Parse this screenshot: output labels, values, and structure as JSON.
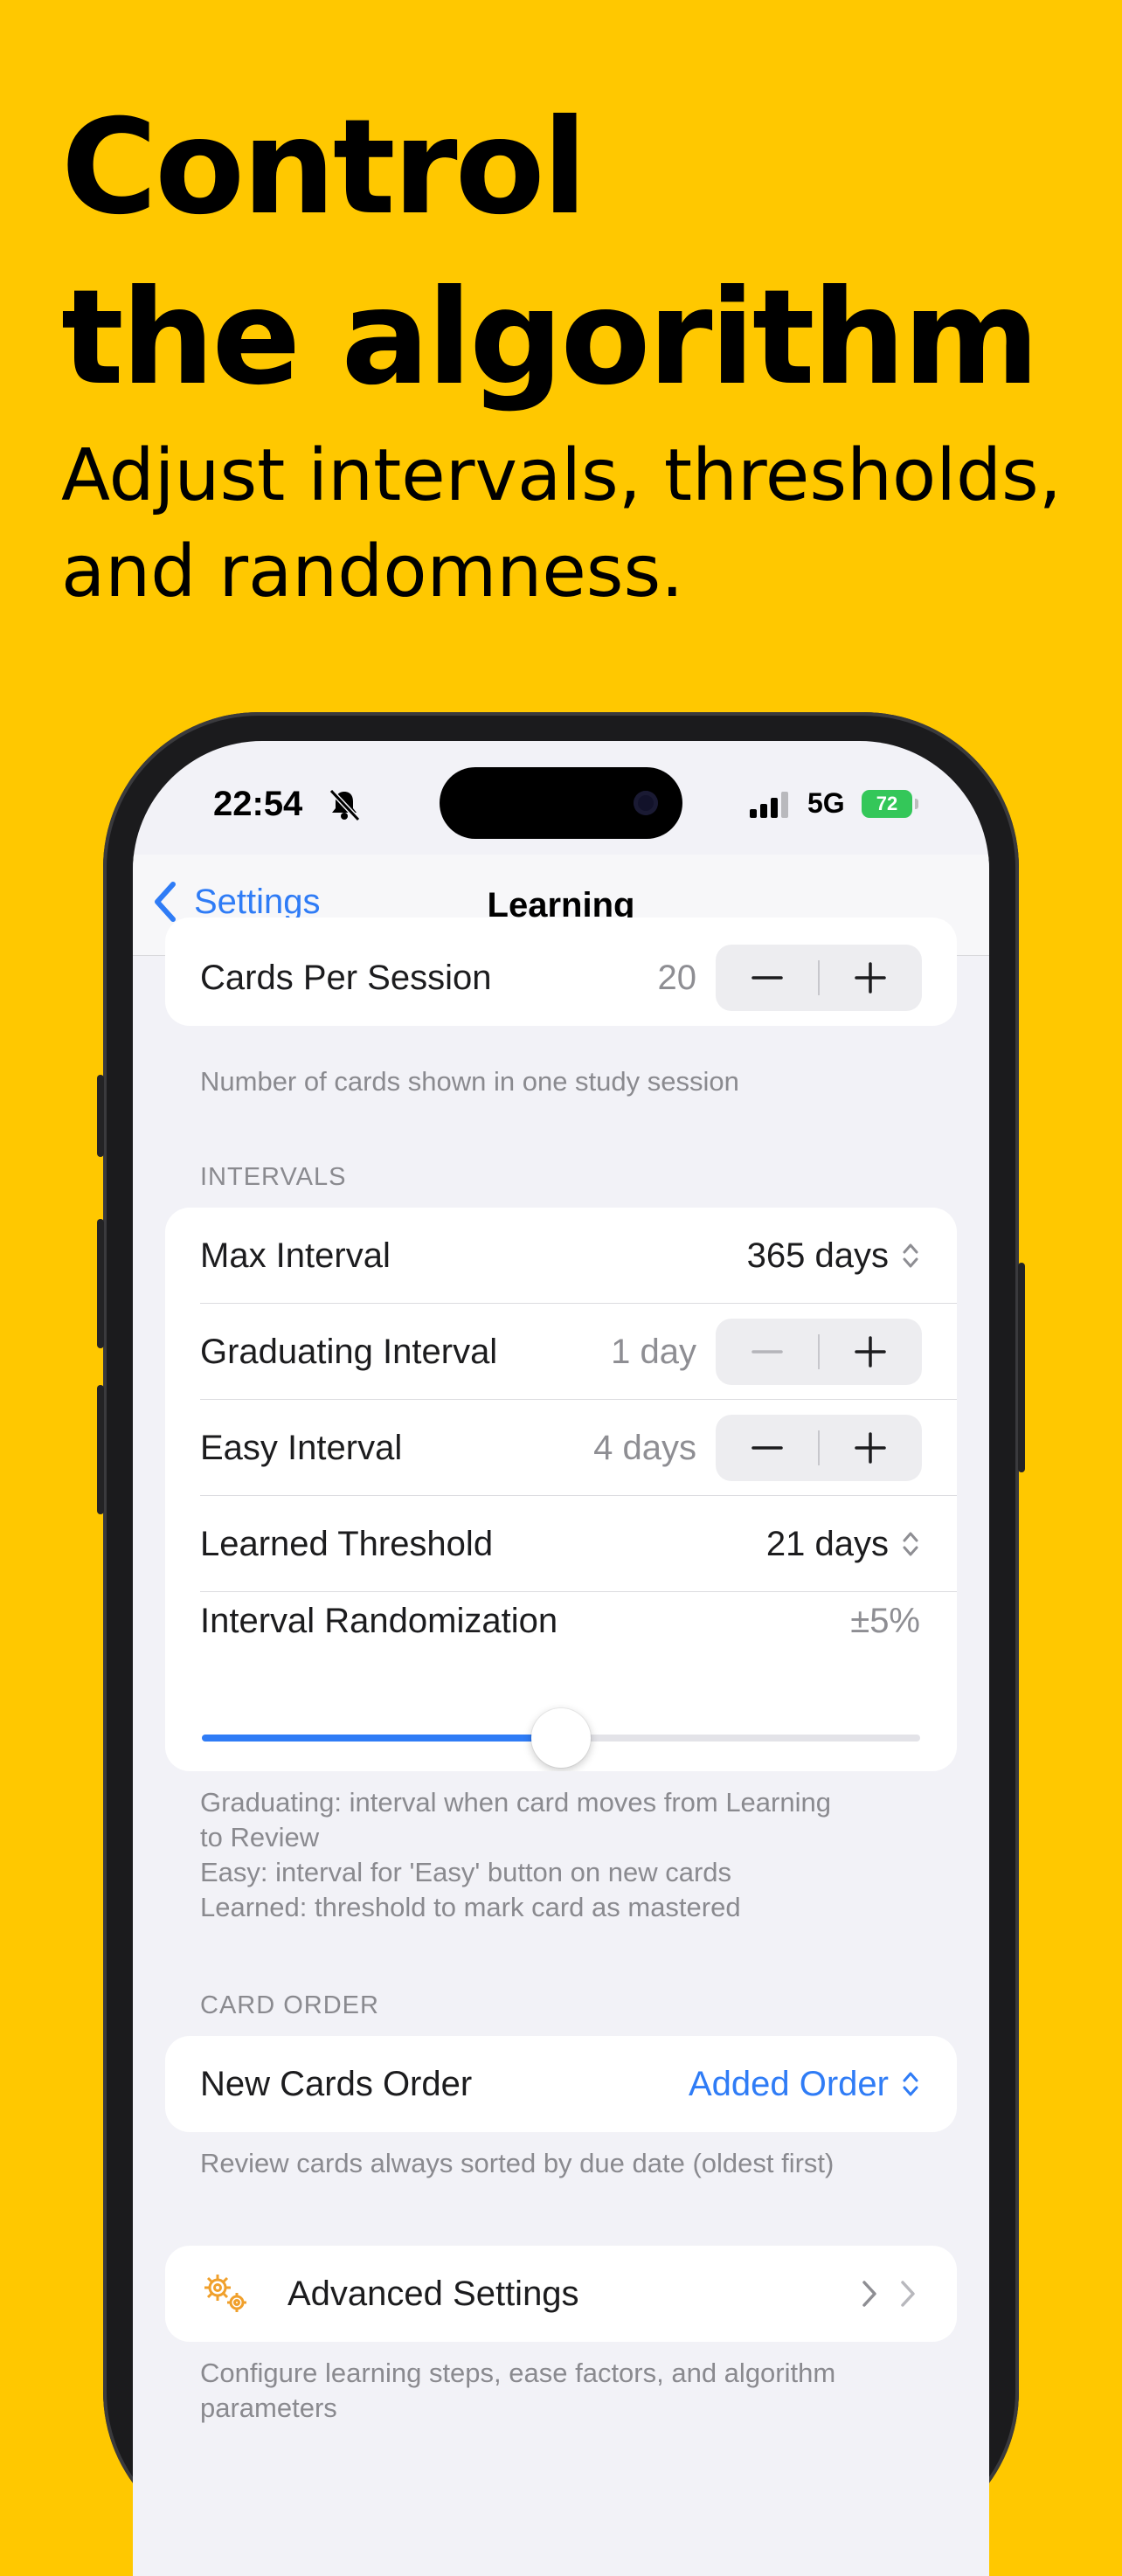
{
  "promo": {
    "headline_line1": "Control",
    "headline_line2": "the algorithm",
    "subhead_line1": "Adjust intervals, thresholds,",
    "subhead_line2": "and randomness."
  },
  "status_bar": {
    "time": "22:54",
    "network": "5G",
    "battery": "72",
    "icons": [
      "bell-slash-icon",
      "signal-icon",
      "battery-icon"
    ]
  },
  "nav": {
    "back_label": "Settings",
    "title": "Learning"
  },
  "session": {
    "label": "Cards Per Session",
    "value": "20",
    "footnote": "Number of cards shown in one study session"
  },
  "intervals": {
    "header": "INTERVALS",
    "max_interval": {
      "label": "Max Interval",
      "value": "365 days"
    },
    "graduating_interval": {
      "label": "Graduating Interval",
      "value": "1 day"
    },
    "easy_interval": {
      "label": "Easy Interval",
      "value": "4 days"
    },
    "learned_threshold": {
      "label": "Learned Threshold",
      "value": "21 days"
    },
    "randomization": {
      "label": "Interval Randomization",
      "value": "±5%",
      "slider_fraction": 0.5
    },
    "footnote_line1": "Graduating: interval when card moves from Learning",
    "footnote_line2": "to Review",
    "footnote_line3": "Easy: interval for 'Easy' button on new cards",
    "footnote_line4": "Learned: threshold to mark card as mastered"
  },
  "card_order": {
    "header": "CARD ORDER",
    "label": "New Cards Order",
    "value": "Added Order",
    "footnote": "Review cards always sorted by due date (oldest first)"
  },
  "advanced": {
    "label": "Advanced Settings",
    "icon": "gears-icon",
    "footnote_line1": "Configure learning steps, ease factors, and algorithm",
    "footnote_line2": "parameters"
  },
  "colors": {
    "background": "#FFC800",
    "accent": "#2F7CF6",
    "battery": "#34C759",
    "gear_icon": "#F0A02C"
  }
}
